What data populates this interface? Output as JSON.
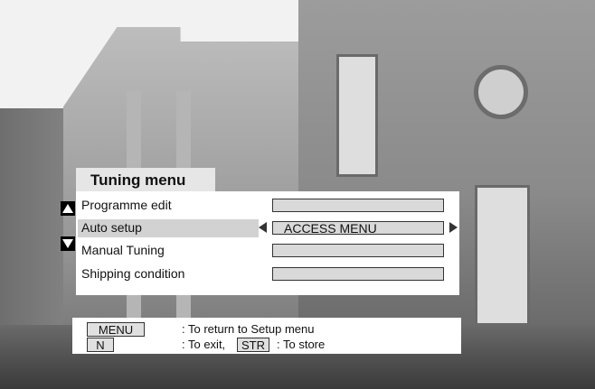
{
  "menu": {
    "title": "Tuning menu",
    "items": [
      {
        "label": "Programme edit",
        "value": ""
      },
      {
        "label": "Auto setup",
        "value": "ACCESS MENU"
      },
      {
        "label": "Manual Tuning",
        "value": ""
      },
      {
        "label": "Shipping condition",
        "value": ""
      }
    ],
    "selected_index": 1
  },
  "help": {
    "menu_key": "MENU",
    "menu_text": ": To return to Setup menu",
    "n_key": "N",
    "n_text": ": To exit,",
    "str_key": "STR",
    "str_text": ": To store"
  },
  "icons": {
    "scroll_up": "up-triangle-icon",
    "scroll_down": "down-triangle-icon",
    "value_prev": "left-arrow-icon",
    "value_next": "right-arrow-icon"
  }
}
